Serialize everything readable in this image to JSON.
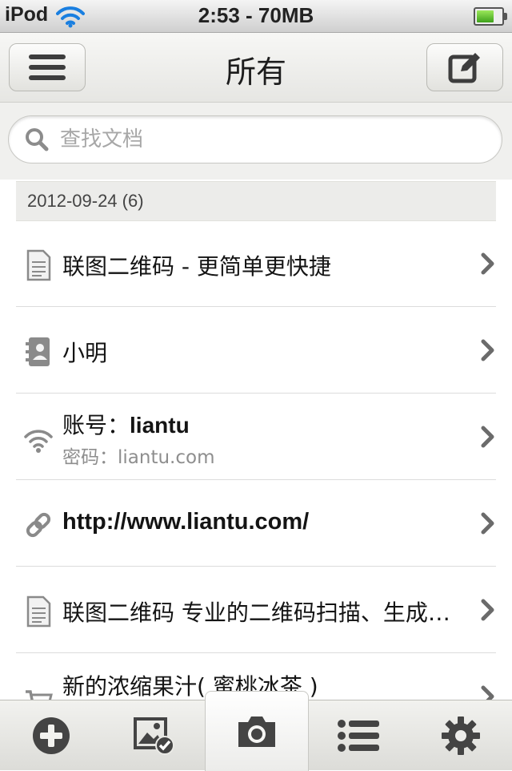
{
  "status_bar": {
    "carrier": "iPod",
    "time": "2:53 - 70MB",
    "battery_level": 0.7
  },
  "nav": {
    "title": "所有"
  },
  "search": {
    "placeholder": "查找文档",
    "value": ""
  },
  "date_header": {
    "label": "2012-09-24 (6)"
  },
  "items": [
    {
      "type": "document-icon",
      "title": "联图二维码 - 更简单更快捷"
    },
    {
      "type": "contact-card-icon",
      "title": "小明"
    },
    {
      "type": "wifi-icon",
      "title_prefix": "账号：",
      "title_value": "liantu",
      "subtitle": "密码：liantu.com"
    },
    {
      "type": "link-icon",
      "title": "http://www.liantu.com/"
    },
    {
      "type": "document-icon",
      "title": "联图二维码 专业的二维码扫描、生成工具"
    },
    {
      "type": "cart-icon",
      "title": "新的浓缩果汁( 蜜桃冰茶 )"
    }
  ],
  "tabs": [
    {
      "icon": "add-circle-icon"
    },
    {
      "icon": "image-check-icon"
    },
    {
      "icon": "camera-icon",
      "selected": true
    },
    {
      "icon": "list-icon"
    },
    {
      "icon": "gear-icon"
    }
  ],
  "colors": {
    "icon_gray": "#444444",
    "list_icon_gray": "#8a8a8a",
    "chevron": "#6b6b6b"
  }
}
